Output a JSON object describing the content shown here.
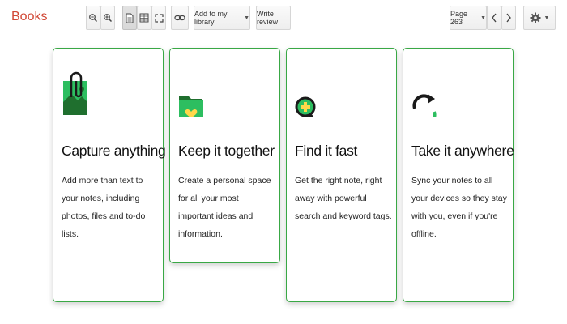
{
  "app": {
    "title": "Books"
  },
  "toolbar": {
    "zoom_out_icon": "zoom-out-icon",
    "zoom_in_icon": "zoom-in-icon",
    "single_page_icon": "single-page-icon",
    "two_page_icon": "two-page-icon",
    "fullscreen_icon": "fullscreen-icon",
    "link_icon": "link-icon",
    "add_to_library_label": "Add to my library",
    "write_review_label": "Write review",
    "page_label": "Page 263",
    "prev_icon": "chevron-left-icon",
    "next_icon": "chevron-right-icon",
    "settings_icon": "gear-icon"
  },
  "cards": [
    {
      "title": "Capture anything",
      "description": "Add more than text to your notes, including photos, files and to-do lists.",
      "icon": "paperclip-image-icon"
    },
    {
      "title": "Keep it together",
      "description": "Create a personal space for all your most important ideas and information.",
      "icon": "folder-heart-icon"
    },
    {
      "title": "Find it fast",
      "description": "Get the right note, right away with powerful search and keyword tags.",
      "icon": "magnifier-icon"
    },
    {
      "title": "Take it anywhere",
      "description": "Sync your notes to all your devices so they stay with you, even if you're offline.",
      "icon": "sync-icon"
    }
  ],
  "colors": {
    "brand": "#d14836",
    "accent": "#39a845",
    "accent_dark": "#1f6f2e"
  }
}
